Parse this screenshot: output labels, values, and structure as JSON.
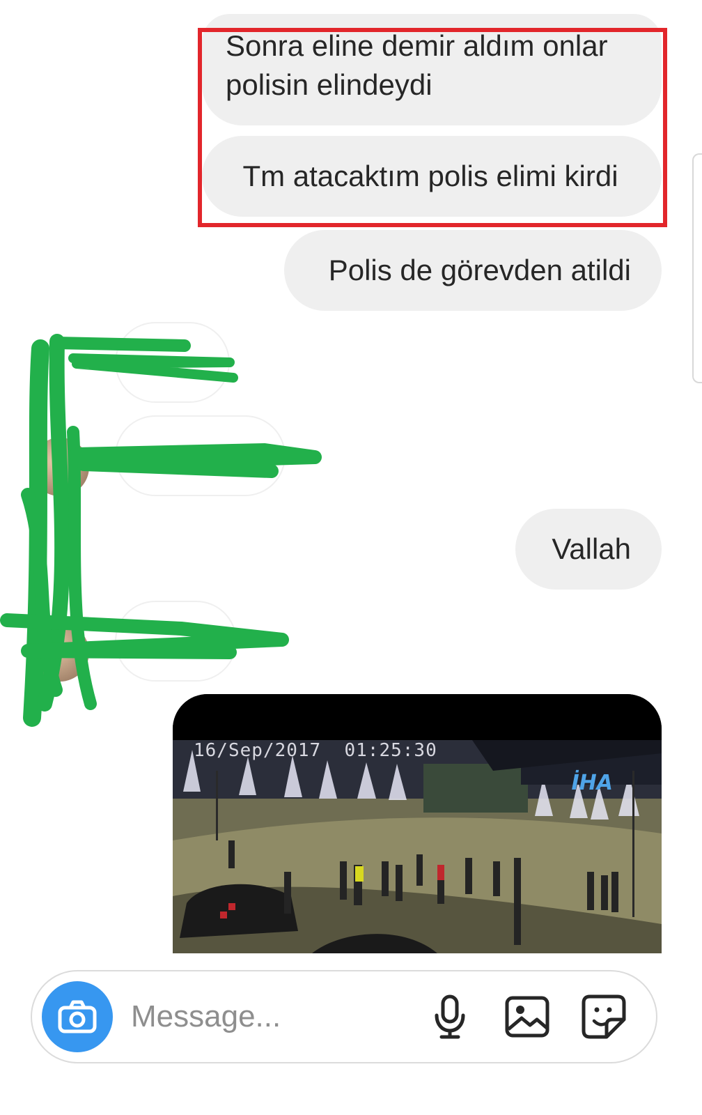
{
  "messages": {
    "outgoing": [
      {
        "text": "Sonra eline demir aldım onlar polisin elindeydi"
      },
      {
        "text": "Tm atacaktım polis elimi kirdi"
      },
      {
        "text": "Polis de görevden atildi"
      },
      {
        "text": "Vallah"
      }
    ],
    "media": {
      "timestamp": "16/Sep/2017  01:25:30",
      "watermark": "İHA"
    }
  },
  "composer": {
    "placeholder": "Message...",
    "icons": {
      "camera": "camera-icon",
      "mic": "microphone-icon",
      "gallery": "gallery-icon",
      "sticker": "sticker-icon"
    }
  },
  "colors": {
    "bubble": "#efefef",
    "camera_button": "#3797f0",
    "highlight": "#e2262b",
    "scribble": "#22b04b"
  }
}
